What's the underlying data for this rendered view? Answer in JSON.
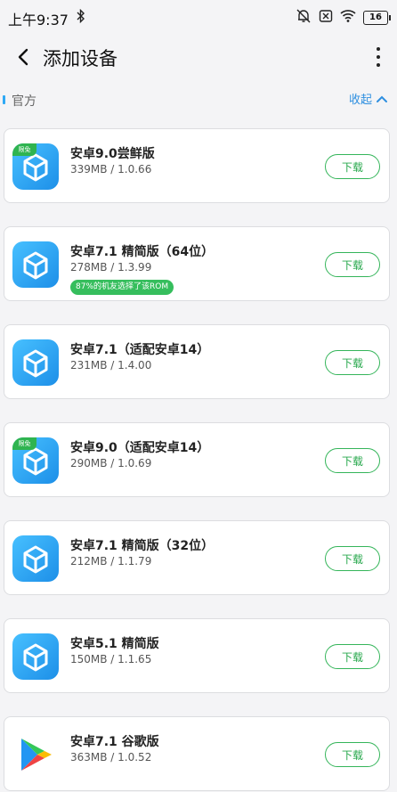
{
  "status_bar": {
    "time": "上午9:37",
    "battery": "16"
  },
  "header": {
    "title": "添加设备"
  },
  "section": {
    "title": "官方",
    "toggle_label": "收起"
  },
  "cards": [
    {
      "name": "安卓9.0尝鲜版",
      "meta": "339MB / 1.0.66",
      "badge": "限免",
      "tag": "",
      "button": "下载",
      "icon": "vm-icon"
    },
    {
      "name": "安卓7.1 精简版（64位）",
      "meta": "278MB / 1.3.99",
      "badge": "",
      "tag": "87%的机友选择了该ROM",
      "button": "下载",
      "icon": "vm-icon"
    },
    {
      "name": "安卓7.1（适配安卓14）",
      "meta": "231MB / 1.4.00",
      "badge": "",
      "tag": "",
      "button": "下载",
      "icon": "vm-icon"
    },
    {
      "name": "安卓9.0（适配安卓14）",
      "meta": "290MB / 1.0.69",
      "badge": "限免",
      "tag": "",
      "button": "下载",
      "icon": "vm-icon"
    },
    {
      "name": "安卓7.1 精简版（32位）",
      "meta": "212MB / 1.1.79",
      "badge": "",
      "tag": "",
      "button": "下载",
      "icon": "vm-icon"
    },
    {
      "name": "安卓5.1 精简版",
      "meta": "150MB / 1.1.65",
      "badge": "",
      "tag": "",
      "button": "下载",
      "icon": "vm-icon"
    },
    {
      "name": "安卓7.1 谷歌版",
      "meta": "363MB / 1.0.52",
      "badge": "",
      "tag": "",
      "button": "下载",
      "icon": "google-play-icon"
    }
  ]
}
